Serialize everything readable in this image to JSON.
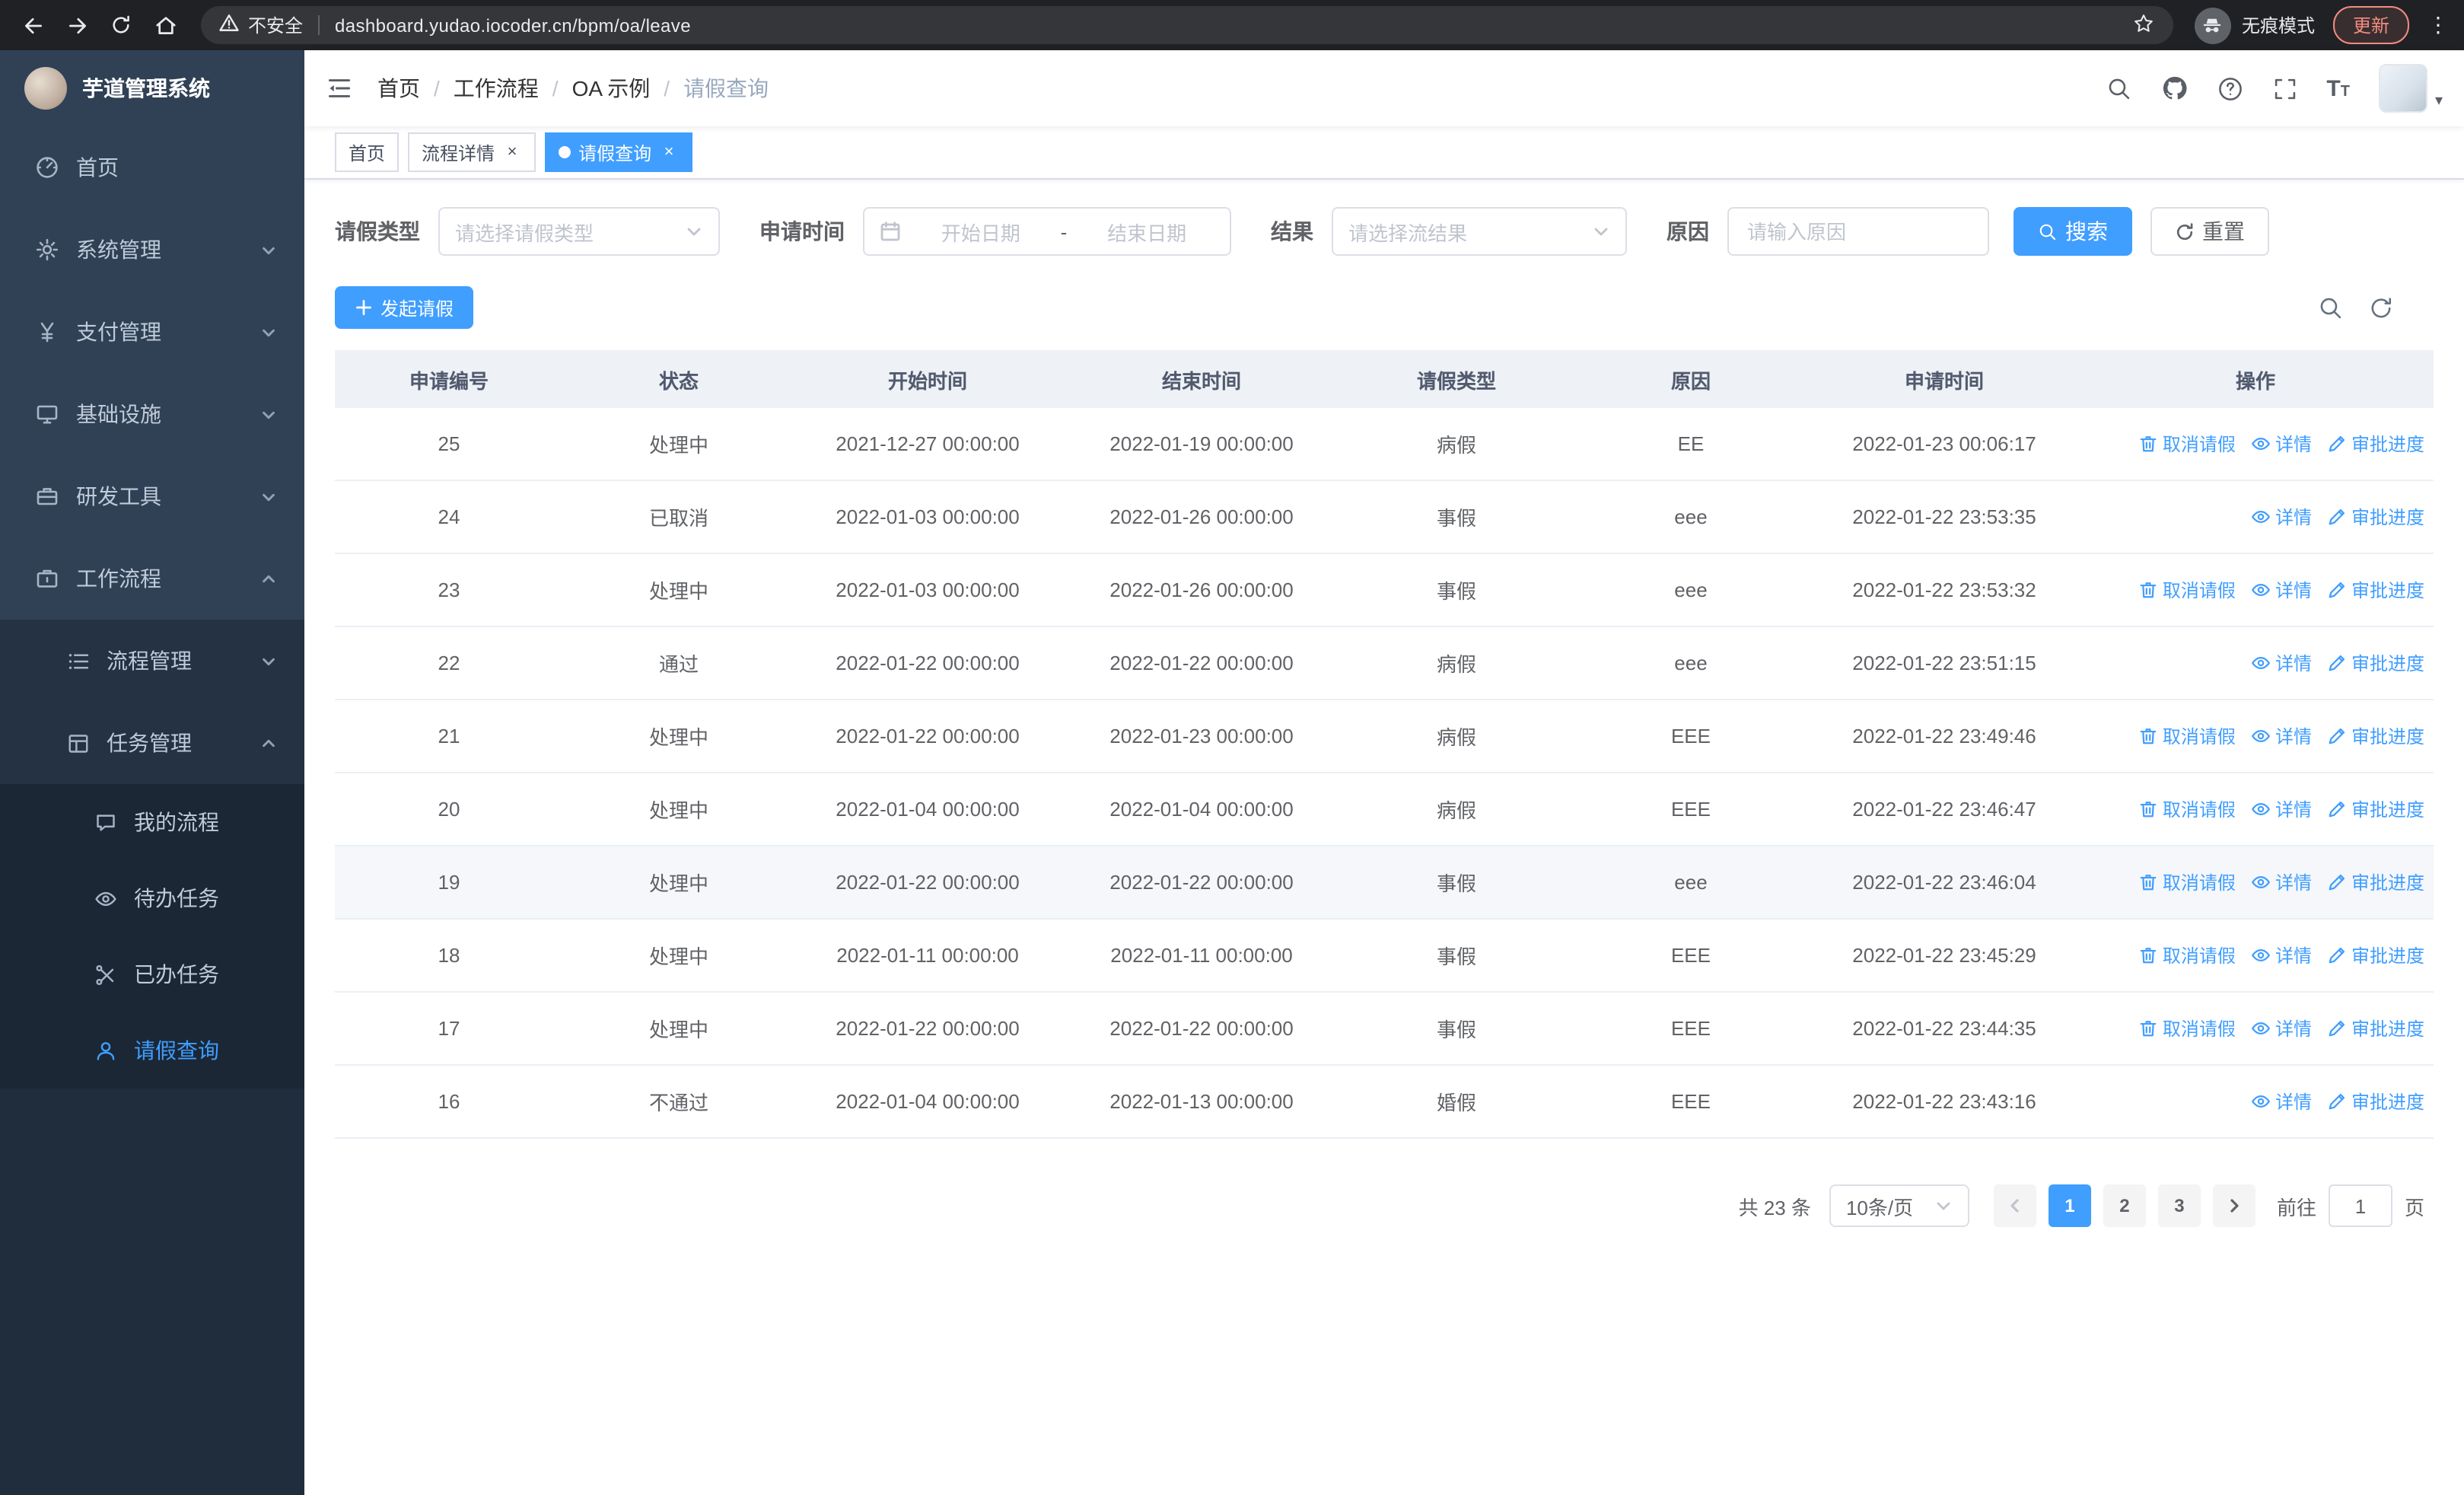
{
  "browser": {
    "security_label": "不安全",
    "url": "dashboard.yudao.iocoder.cn/bpm/oa/leave",
    "incognito_label": "无痕模式",
    "update_label": "更新"
  },
  "sidebar": {
    "logo_title": "芋道管理系统",
    "items_l1": [
      {
        "label": "首页"
      },
      {
        "label": "系统管理"
      },
      {
        "label": "支付管理"
      },
      {
        "label": "基础设施"
      },
      {
        "label": "研发工具"
      },
      {
        "label": "工作流程"
      }
    ],
    "items_l2": [
      {
        "label": "流程管理"
      },
      {
        "label": "任务管理"
      }
    ],
    "items_l3": [
      {
        "label": "我的流程"
      },
      {
        "label": "待办任务"
      },
      {
        "label": "已办任务"
      },
      {
        "label": "请假查询"
      }
    ]
  },
  "header": {
    "breadcrumb": [
      {
        "label": "首页"
      },
      {
        "label": "工作流程"
      },
      {
        "label": "OA 示例"
      },
      {
        "label": "请假查询"
      }
    ]
  },
  "tabs": [
    {
      "label": "首页"
    },
    {
      "label": "流程详情"
    },
    {
      "label": "请假查询"
    }
  ],
  "filters": {
    "leave_type_label": "请假类型",
    "leave_type_placeholder": "请选择请假类型",
    "apply_time_label": "申请时间",
    "start_date_placeholder": "开始日期",
    "range_separator": "-",
    "end_date_placeholder": "结束日期",
    "result_label": "结果",
    "result_placeholder": "请选择流结果",
    "reason_label": "原因",
    "reason_placeholder": "请输入原因",
    "search_label": "搜索",
    "reset_label": "重置"
  },
  "toolbar": {
    "create_label": "发起请假"
  },
  "table": {
    "columns": [
      "申请编号",
      "状态",
      "开始时间",
      "结束时间",
      "请假类型",
      "原因",
      "申请时间",
      "操作"
    ],
    "actions": {
      "cancel": "取消请假",
      "detail": "详情",
      "progress": "审批进度"
    },
    "rows": [
      {
        "id": "25",
        "status": "处理中",
        "start": "2021-12-27 00:00:00",
        "end": "2022-01-19 00:00:00",
        "type": "病假",
        "reason": "EE",
        "apply_time": "2022-01-23 00:06:17",
        "cancellable": true,
        "hover": false
      },
      {
        "id": "24",
        "status": "已取消",
        "start": "2022-01-03 00:00:00",
        "end": "2022-01-26 00:00:00",
        "type": "事假",
        "reason": "eee",
        "apply_time": "2022-01-22 23:53:35",
        "cancellable": false,
        "hover": false
      },
      {
        "id": "23",
        "status": "处理中",
        "start": "2022-01-03 00:00:00",
        "end": "2022-01-26 00:00:00",
        "type": "事假",
        "reason": "eee",
        "apply_time": "2022-01-22 23:53:32",
        "cancellable": true,
        "hover": false
      },
      {
        "id": "22",
        "status": "通过",
        "start": "2022-01-22 00:00:00",
        "end": "2022-01-22 00:00:00",
        "type": "病假",
        "reason": "eee",
        "apply_time": "2022-01-22 23:51:15",
        "cancellable": false,
        "hover": false
      },
      {
        "id": "21",
        "status": "处理中",
        "start": "2022-01-22 00:00:00",
        "end": "2022-01-23 00:00:00",
        "type": "病假",
        "reason": "EEE",
        "apply_time": "2022-01-22 23:49:46",
        "cancellable": true,
        "hover": false
      },
      {
        "id": "20",
        "status": "处理中",
        "start": "2022-01-04 00:00:00",
        "end": "2022-01-04 00:00:00",
        "type": "病假",
        "reason": "EEE",
        "apply_time": "2022-01-22 23:46:47",
        "cancellable": true,
        "hover": false
      },
      {
        "id": "19",
        "status": "处理中",
        "start": "2022-01-22 00:00:00",
        "end": "2022-01-22 00:00:00",
        "type": "事假",
        "reason": "eee",
        "apply_time": "2022-01-22 23:46:04",
        "cancellable": true,
        "hover": true
      },
      {
        "id": "18",
        "status": "处理中",
        "start": "2022-01-11 00:00:00",
        "end": "2022-01-11 00:00:00",
        "type": "事假",
        "reason": "EEE",
        "apply_time": "2022-01-22 23:45:29",
        "cancellable": true,
        "hover": false
      },
      {
        "id": "17",
        "status": "处理中",
        "start": "2022-01-22 00:00:00",
        "end": "2022-01-22 00:00:00",
        "type": "事假",
        "reason": "EEE",
        "apply_time": "2022-01-22 23:44:35",
        "cancellable": true,
        "hover": false
      },
      {
        "id": "16",
        "status": "不通过",
        "start": "2022-01-04 00:00:00",
        "end": "2022-01-13 00:00:00",
        "type": "婚假",
        "reason": "EEE",
        "apply_time": "2022-01-22 23:43:16",
        "cancellable": false,
        "hover": false
      }
    ]
  },
  "pagination": {
    "total_label": "共 23 条",
    "page_size_label": "10条/页",
    "pages": [
      "1",
      "2",
      "3"
    ],
    "active_page": "1",
    "goto_label": "前往",
    "goto_value": "1",
    "unit_label": "页"
  },
  "colors": {
    "primary": "#409EFF",
    "sidebar_bg": "#304156",
    "sidebar_sub_bg": "#1f2d3d",
    "chrome_bg": "#202124",
    "table_header_bg": "#eef1f6"
  }
}
